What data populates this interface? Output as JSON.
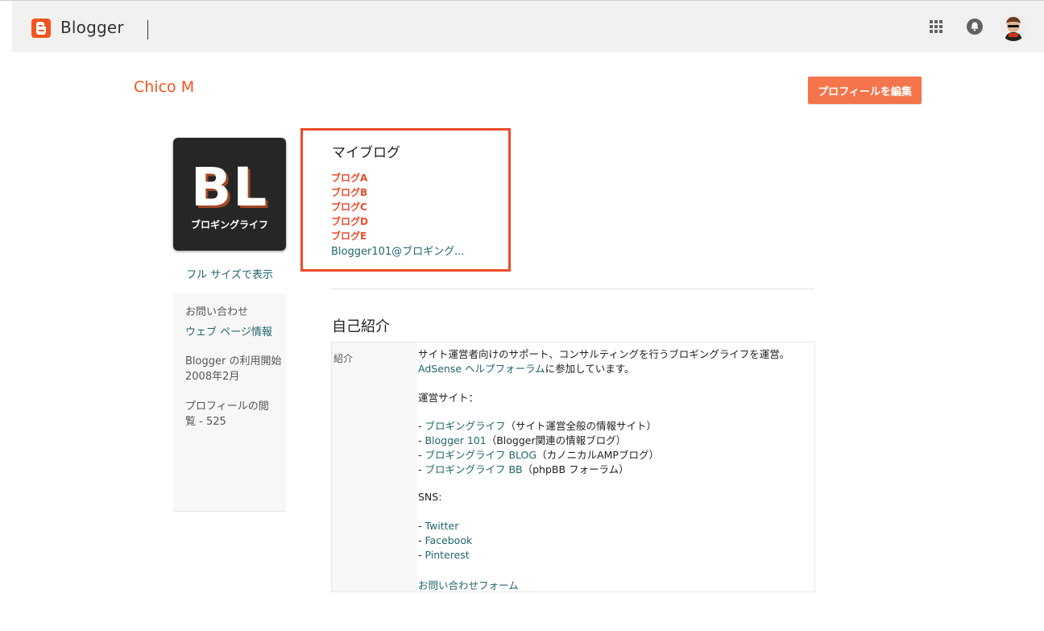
{
  "header": {
    "brand": "Blogger"
  },
  "colors": {
    "accent": "#f4541f",
    "link": "#21666b",
    "highlight": "#ec4b2c"
  },
  "profile": {
    "name": "Chico M",
    "edit_button": "プロフィールを編集",
    "photo_text": "BL",
    "photo_subtext": "ブロギングライフ",
    "full_size_link": "フル サイズで表示"
  },
  "sidebar": {
    "contact": "お問い合わせ",
    "web_page_info": "ウェブ ページ情報",
    "member_since_label": "Blogger の利用開始",
    "member_since_value": "2008年2月",
    "profile_views_label": "プロフィールの閲",
    "profile_views_value": "覧 - 525"
  },
  "my_blogs": {
    "title": "マイブログ",
    "items": [
      "ブログA",
      "ブログB",
      "ブログC",
      "ブログD",
      "ブログE",
      "Blogger101@ブロギング..."
    ]
  },
  "about": {
    "title": "自己紹介",
    "label": "紹介",
    "intro": "サイト運営者向けのサポート、コンサルティングを行うブロギングライフを運営。",
    "adsense_link": "AdSense ヘルプフォーラム",
    "adsense_suffix": "に参加しています。",
    "sites_heading": "運営サイト：",
    "sites": [
      {
        "prefix": "- ",
        "link": "ブロギングライフ",
        "suffix": "（サイト運営全般の情報サイト）"
      },
      {
        "prefix": "- ",
        "link": "Blogger 101",
        "suffix": "（Blogger関連の情報ブログ）"
      },
      {
        "prefix": "- ",
        "link": "ブロギングライフ BLOG",
        "suffix": "（カノニカルAMPブログ）"
      },
      {
        "prefix": "- ",
        "link": "ブロギングライフ BB",
        "suffix": "（phpBB フォーラム）"
      }
    ],
    "sns_heading": "SNS:",
    "sns": [
      {
        "prefix": "- ",
        "link": "Twitter"
      },
      {
        "prefix": "- ",
        "link": "Facebook"
      },
      {
        "prefix": "- ",
        "link": "Pinterest"
      }
    ],
    "contact_form": "お問い合わせフォーム"
  }
}
